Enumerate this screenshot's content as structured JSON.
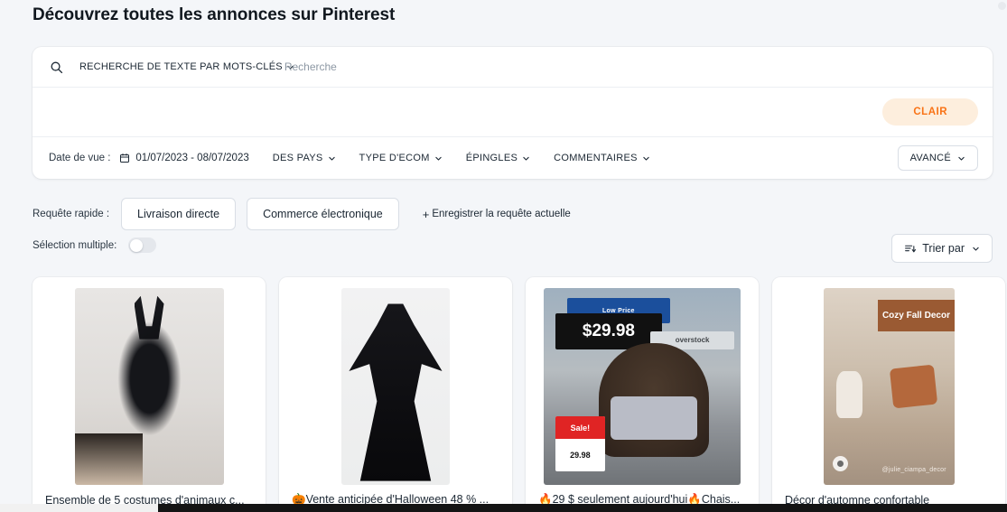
{
  "page": {
    "title": "Découvrez toutes les annonces sur Pinterest"
  },
  "search": {
    "icon": "search-icon",
    "keyword_mode_label": "RECHERCHE DE TEXTE PAR MOTS-CLÉS",
    "input_value": "",
    "input_placeholder": "Recherche",
    "clear_label": "CLAIR"
  },
  "filters": {
    "date_label": "Date de vue :",
    "date_icon": "calendar-icon",
    "date_range": "01/07/2023 - 08/07/2023",
    "items": [
      {
        "label": "DES PAYS"
      },
      {
        "label": "TYPE D'ECOM"
      },
      {
        "label": "ÉPINGLES"
      },
      {
        "label": "COMMENTAIRES"
      }
    ],
    "advanced_label": "AVANCÉ"
  },
  "quick_query": {
    "label": "Requête rapide :",
    "chips": [
      {
        "label": "Livraison directe"
      },
      {
        "label": "Commerce électronique"
      }
    ],
    "save_label": "Enregistrer la requête actuelle",
    "save_plus": "+"
  },
  "multi_select": {
    "label": "Sélection multiple:",
    "state": "off"
  },
  "sort": {
    "icon": "sort-icon",
    "label": "Trier par"
  },
  "colors": {
    "page_background": "#f4f6f9",
    "panel_background": "#ffffff",
    "clear_button_background": "#fdeedd",
    "clear_button_text": "#f97316",
    "text_primary": "#1b2733",
    "border": "#d9dee5"
  },
  "cards": [
    {
      "title": "Ensemble de 5 costumes d'animaux c...",
      "overlays": {}
    },
    {
      "title": "🎃Vente anticipée d'Halloween 48 % ...",
      "overlays": {}
    },
    {
      "title": "🔥29 $ seulement aujourd'hui🔥Chais...",
      "overlays": {
        "banner": "Low Price",
        "price": "$29.98",
        "brand": "overstock",
        "sale_tag": "Sale!",
        "sale_price": "29.98"
      }
    },
    {
      "title": "Décor d'automne confortable",
      "overlays": {
        "badge": "Cozy Fall Decor",
        "handle": "@julie_ciampa_decor"
      }
    }
  ]
}
